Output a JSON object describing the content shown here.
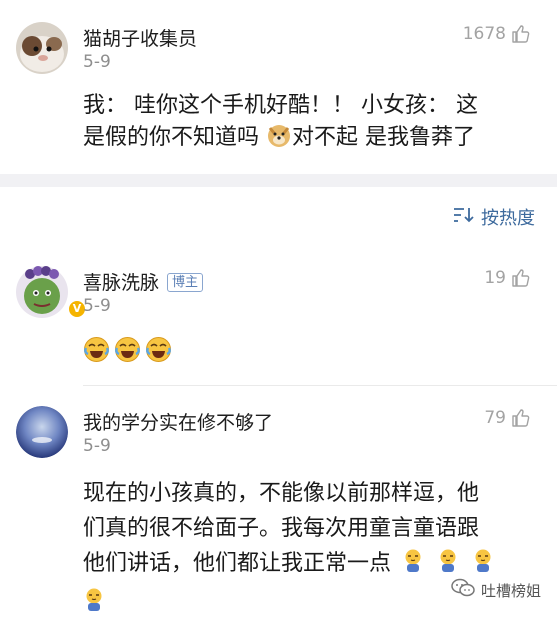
{
  "comments": [
    {
      "name": "猫胡子收集员",
      "date": "5-9",
      "likes": "1678",
      "text_line1": "我：  哇你这个手机好酷！！   小女孩：  这",
      "text_line2a": "是假的你不知道吗 ",
      "emoji": "doge-emoji",
      "text_line2b": "对不起 是我鲁莽了"
    },
    {
      "name": "喜脉洗脉",
      "badge": "博主",
      "date": "5-9",
      "likes": "19",
      "emojis": [
        "laugh-cry-emoji",
        "laugh-cry-emoji",
        "laugh-cry-emoji"
      ]
    },
    {
      "name": "我的学分实在修不够了",
      "date": "5-9",
      "likes": "79",
      "text_line1": "现在的小孩真的，不能像以前那样逗，他",
      "text_line2": "们真的很不给面子。我每次用童言童语跟",
      "text_line3": "他们讲话，他们都让我正常一点",
      "emojis": [
        "sleepy-baby-emoji",
        "sleepy-baby-emoji",
        "sleepy-baby-emoji",
        "sleepy-baby-emoji"
      ]
    }
  ],
  "sort": {
    "label": "按热度",
    "icon": "sort-icon"
  },
  "watermark": {
    "text": "吐槽榜姐",
    "icon": "wechat-icon"
  },
  "colors": {
    "link": "#3d6a9d",
    "muted": "#8e8e8e",
    "divider": "#f1f1f4",
    "vip": "#f5b400"
  }
}
